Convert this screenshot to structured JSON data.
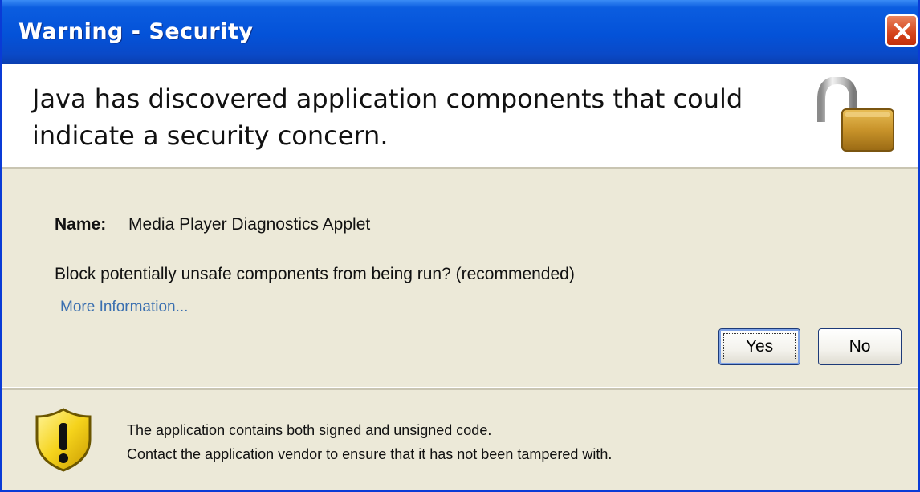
{
  "window": {
    "title": "Warning - Security"
  },
  "header": {
    "message": "Java has discovered application components that could indicate a security concern."
  },
  "details": {
    "name_label": "Name:",
    "name_value": "Media Player Diagnostics Applet",
    "question": "Block potentially unsafe components from being run? (recommended)",
    "more_info_link": "More Information..."
  },
  "buttons": {
    "yes_label": "Yes",
    "no_label": "No"
  },
  "footer": {
    "line1": "The application contains both signed and unsigned code.",
    "line2": "Contact the application vendor to ensure that it has not been tampered with."
  },
  "icons": {
    "header": "unlocked-padlock-icon",
    "footer": "warning-shield-icon",
    "close": "close-icon"
  },
  "colors": {
    "titlebar": "#0452d8",
    "close_button": "#d5431b",
    "link": "#3a6fb0",
    "dialog_background": "#ece9d8"
  }
}
